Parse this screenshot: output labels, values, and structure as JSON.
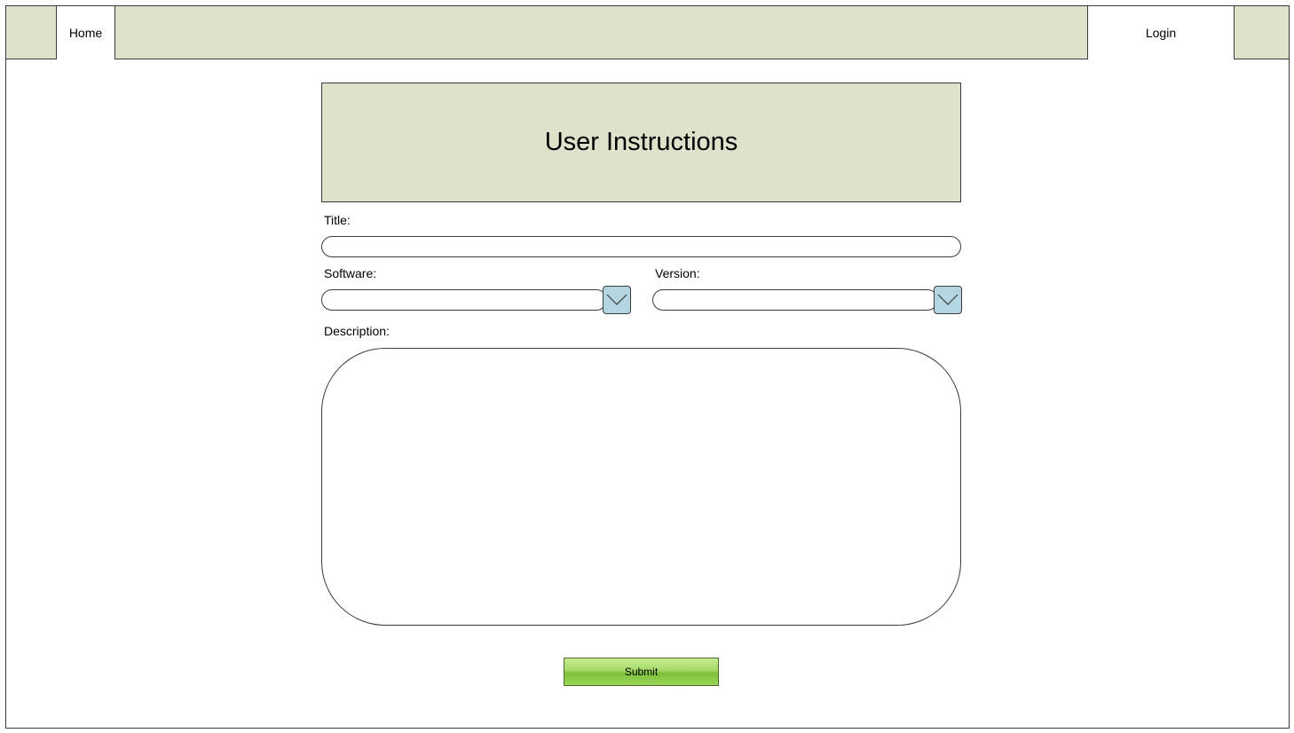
{
  "nav": {
    "home_label": "Home",
    "login_label": "Login"
  },
  "header": {
    "title": "User Instructions"
  },
  "form": {
    "title_label": "Title:",
    "title_value": "",
    "software_label": "Software:",
    "software_value": "",
    "version_label": "Version:",
    "version_value": "",
    "description_label": "Description:",
    "description_value": "",
    "submit_label": "Submit"
  },
  "colors": {
    "nav_bg": "#dee2cb",
    "dropdown_button": "#b3d6e2",
    "submit_green": "#9bd558"
  },
  "icons": {
    "dropdown": "chevron-down-icon"
  }
}
